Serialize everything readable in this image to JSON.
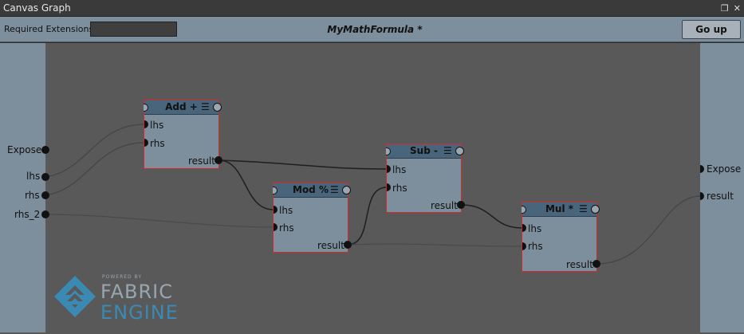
{
  "window": {
    "title": "Canvas Graph",
    "restore_icon": "restore-icon",
    "close_icon": "close-icon"
  },
  "toolbar": {
    "required_extensions_label": "Required Extensions:",
    "required_extensions_value": "",
    "graph_name": "MyMathFormula *",
    "go_up_label": "Go up"
  },
  "left_panel": {
    "ports": [
      {
        "label": "Expose"
      },
      {
        "label": "lhs"
      },
      {
        "label": "rhs"
      },
      {
        "label": "rhs_2"
      }
    ]
  },
  "right_panel": {
    "ports": [
      {
        "label": "Expose"
      },
      {
        "label": "result"
      }
    ]
  },
  "nodes": {
    "add": {
      "title": "Add +",
      "inputs": [
        "lhs",
        "rhs"
      ],
      "output": "result"
    },
    "mod": {
      "title": "Mod %",
      "inputs": [
        "lhs",
        "rhs"
      ],
      "output": "result"
    },
    "sub": {
      "title": "Sub -",
      "inputs": [
        "lhs",
        "rhs"
      ],
      "output": "result"
    },
    "mul": {
      "title": "Mul *",
      "inputs": [
        "lhs",
        "rhs"
      ],
      "output": "result"
    }
  },
  "logo": {
    "powered_by": "POWERED BY",
    "line1": "FABRIC",
    "line2": "ENGINE"
  },
  "colors": {
    "canvas_bg": "#595959",
    "panel_bg": "#7d8e9c",
    "node_header": "#48657b",
    "node_border_selected": "#d22a2a",
    "logo_blue": "#3a8ab3"
  }
}
